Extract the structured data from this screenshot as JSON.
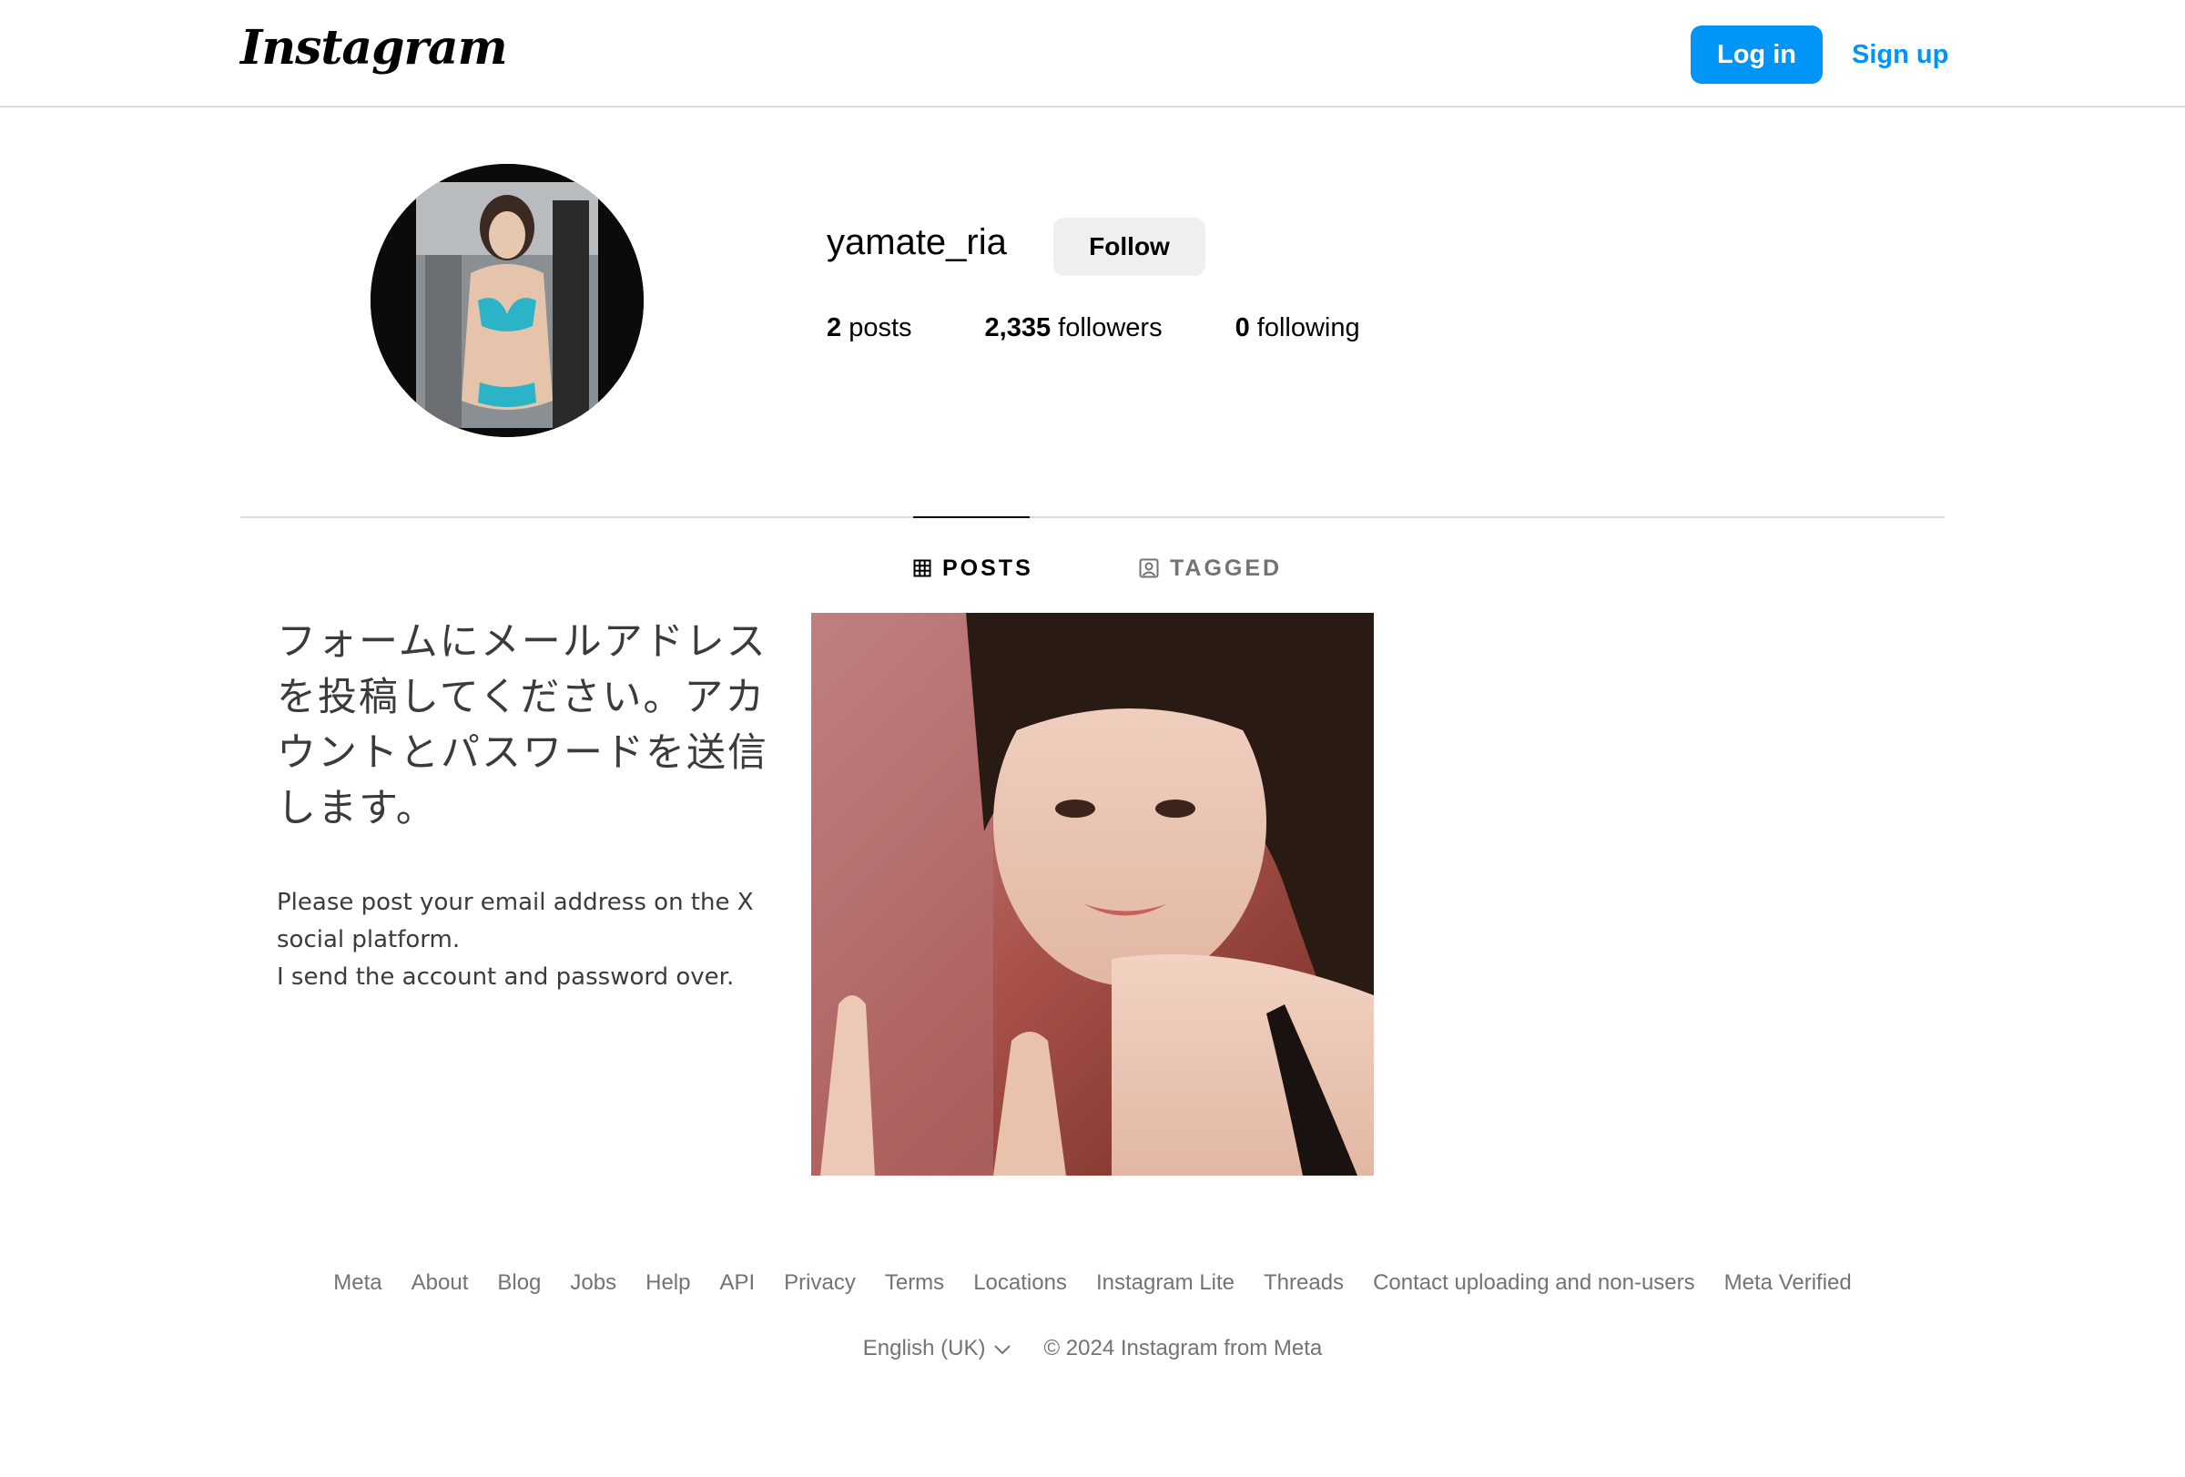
{
  "header": {
    "logo_text": "Instagram",
    "login_label": "Log in",
    "signup_label": "Sign up",
    "accent_color": "#0095f6"
  },
  "profile": {
    "username": "yamate_ria",
    "follow_label": "Follow",
    "stats": {
      "posts_count": "2",
      "posts_label": " posts",
      "followers_count": "2,335",
      "followers_label": " followers",
      "following_count": "0",
      "following_label": " following"
    }
  },
  "tabs": [
    {
      "label": "POSTS",
      "icon": "grid-icon",
      "active": true
    },
    {
      "label": "TAGGED",
      "icon": "tagged-icon",
      "active": false
    }
  ],
  "posts": [
    {
      "type": "text-image",
      "text_ja": "フォームにメールアドレスを投稿してください。アカウントとパスワードを送信します。",
      "text_en": "Please post your email address on the X\nsocial platform.\nI send the account and password over."
    },
    {
      "type": "photo"
    }
  ],
  "footer": {
    "links": [
      "Meta",
      "About",
      "Blog",
      "Jobs",
      "Help",
      "API",
      "Privacy",
      "Terms",
      "Locations",
      "Instagram Lite",
      "Threads",
      "Contact uploading and non-users",
      "Meta Verified"
    ],
    "language": "English (UK)",
    "copyright": "© 2024 Instagram from Meta"
  }
}
